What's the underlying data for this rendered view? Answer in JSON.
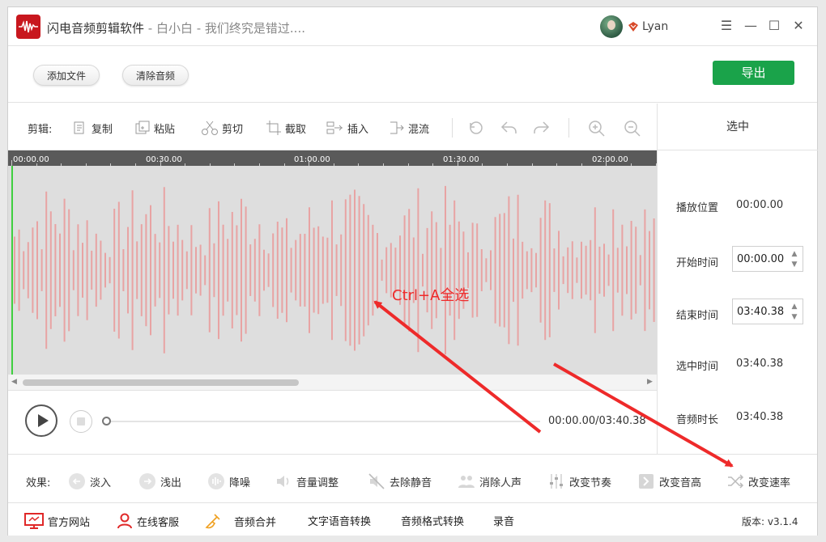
{
  "app": {
    "title": "闪电音频剪辑软件",
    "subtitle": " - 白小白 - 我们终究是错过....",
    "username": "Lyan"
  },
  "topbar": {
    "add_file": "添加文件",
    "clear_audio": "清除音频",
    "export": "导出"
  },
  "editbar": {
    "label": "剪辑:",
    "copy": "复制",
    "paste": "粘贴",
    "cut": "剪切",
    "crop": "截取",
    "insert": "插入",
    "mix": "混流"
  },
  "timeline": {
    "ticks": [
      "00:00.00",
      "00:30.00",
      "01:00.00",
      "01:30.00",
      "02:00.00"
    ]
  },
  "selection_panel": {
    "heading": "选中",
    "play_position_label": "播放位置",
    "play_position": "00:00.00",
    "start_label": "开始时间",
    "start_value": "00:00.00",
    "end_label": "结束时间",
    "end_value": "03:40.38",
    "selected_label": "选中时间",
    "selected_value": "03:40.38",
    "duration_label": "音频时长",
    "duration_value": "03:40.38"
  },
  "player": {
    "time_readout": "00:00.00/03:40.38",
    "progress": 0.0
  },
  "effects": {
    "label": "效果:",
    "fade_in": "淡入",
    "fade_out": "浅出",
    "denoise": "降噪",
    "volume": "音量调整",
    "remove_silence": "去除静音",
    "remove_vocals": "消除人声",
    "change_tempo": "改变节奏",
    "change_pitch": "改变音高",
    "change_speed": "改变速率"
  },
  "footer": {
    "website": "官方网站",
    "support": "在线客服",
    "merge": "音频合并",
    "tts": "文字语音转换",
    "format_convert": "音频格式转换",
    "record": "录音",
    "version": "版本: v3.1.4"
  },
  "annotation": {
    "text": "Ctrl+A全选"
  },
  "colors": {
    "accent_green": "#1aa34a",
    "logo_red": "#c8171e",
    "wave_bar": "#e8a3a3",
    "annotation_red": "#ee2a2a"
  }
}
